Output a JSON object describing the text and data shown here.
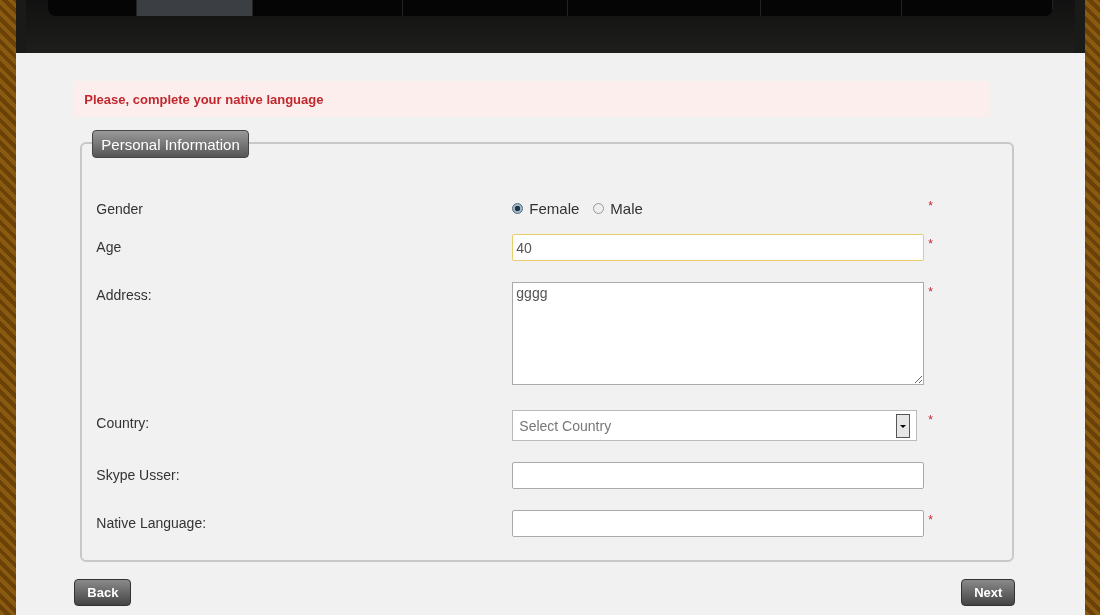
{
  "nav_tabs": [
    {
      "selected": false
    },
    {
      "selected": true
    },
    {
      "selected": false
    },
    {
      "selected": false
    },
    {
      "selected": false
    },
    {
      "selected": false
    },
    {
      "selected": false
    }
  ],
  "error_message": "Please, complete your native language",
  "fieldset": {
    "legend": "Personal Information",
    "fields": [
      {
        "kind": "radio",
        "label": "Gender",
        "required_mark": "*",
        "options": [
          {
            "label": "Female",
            "selected": true
          },
          {
            "label": "Male",
            "selected": false
          }
        ]
      },
      {
        "kind": "text",
        "label": "Age",
        "required_mark": "*",
        "value": "40",
        "focused": true
      },
      {
        "kind": "textarea",
        "label": "Address:",
        "required_mark": "*",
        "value": "gggg"
      },
      {
        "kind": "select",
        "label": "Country:",
        "required_mark": "*",
        "placeholder": "Select Country"
      },
      {
        "kind": "text",
        "label": "Skype Usser:",
        "focused": false
      },
      {
        "kind": "text",
        "label": "Native Language:",
        "required_mark": "*",
        "focused": false
      }
    ]
  },
  "buttons": {
    "back": "Back",
    "next": "Next"
  }
}
